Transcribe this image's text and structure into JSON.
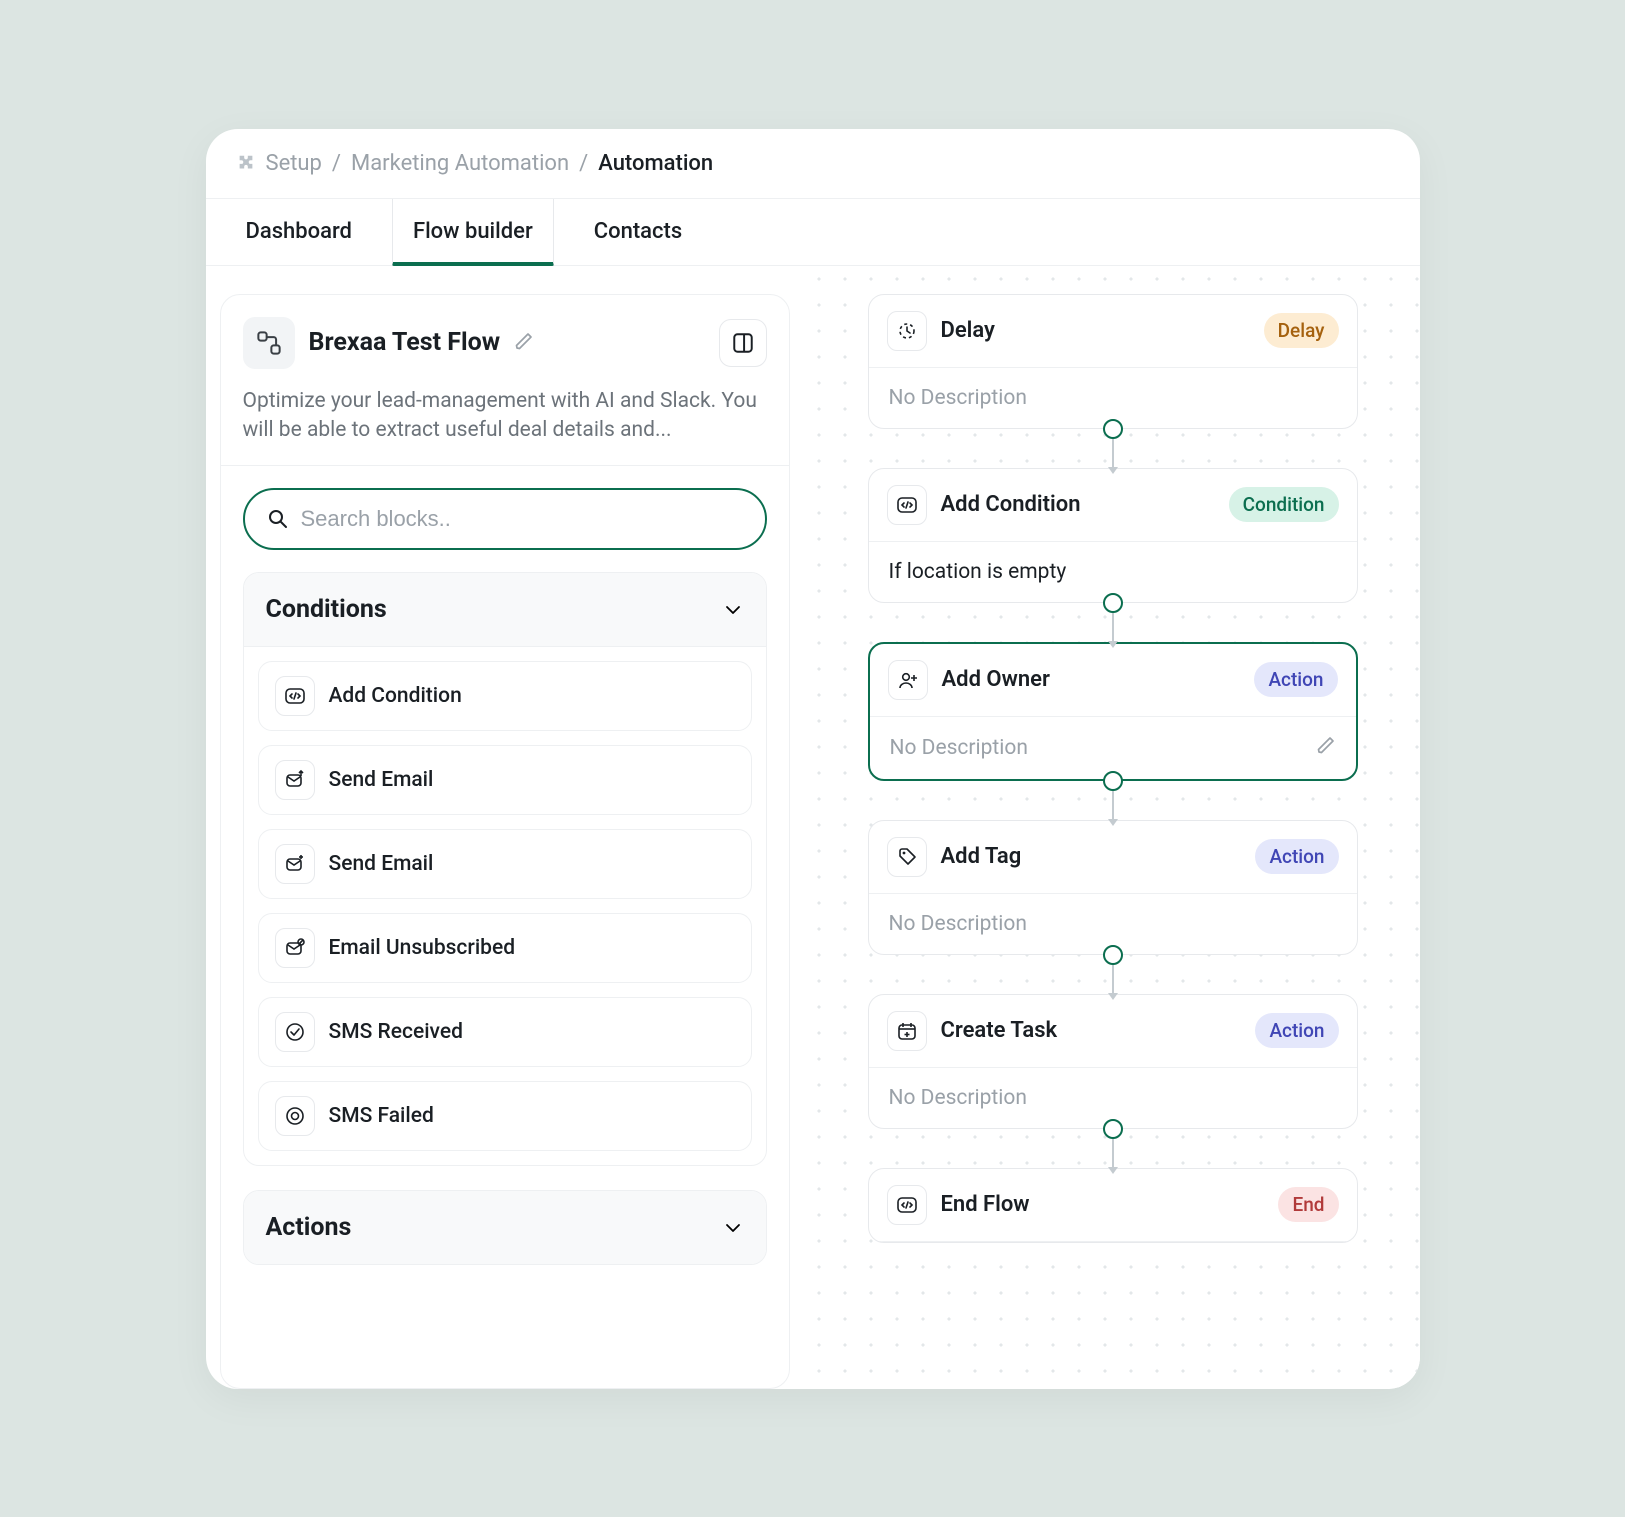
{
  "breadcrumb": {
    "root": "Setup",
    "parent": "Marketing Automation",
    "current": "Automation"
  },
  "tabs": {
    "dashboard": "Dashboard",
    "flow_builder": "Flow builder",
    "contacts": "Contacts"
  },
  "flow": {
    "title": "Brexaa Test Flow",
    "description": "Optimize your lead-management with AI and Slack. You will be able to extract useful deal details and..."
  },
  "search": {
    "placeholder": "Search blocks.."
  },
  "groups": {
    "conditions": {
      "title": "Conditions",
      "items": [
        {
          "label": "Add Condition",
          "icon": "code"
        },
        {
          "label": "Send Email",
          "icon": "mail-up"
        },
        {
          "label": "Send Email",
          "icon": "mail-plus"
        },
        {
          "label": "Email Unsubscribed",
          "icon": "mail-block"
        },
        {
          "label": "SMS Received",
          "icon": "check-circle"
        },
        {
          "label": "SMS Failed",
          "icon": "target"
        }
      ]
    },
    "actions": {
      "title": "Actions"
    }
  },
  "nodes": [
    {
      "title": "Delay",
      "icon": "clock",
      "badge": "Delay",
      "badge_class": "badge-delay",
      "body": "No Description",
      "has_text": false,
      "selected": false,
      "editable": false
    },
    {
      "title": "Add Condition",
      "icon": "code",
      "badge": "Condition",
      "badge_class": "badge-condition",
      "body": "If location is empty",
      "has_text": true,
      "selected": false,
      "editable": false
    },
    {
      "title": "Add Owner",
      "icon": "user-plus",
      "badge": "Action",
      "badge_class": "badge-action",
      "body": "No Description",
      "has_text": false,
      "selected": true,
      "editable": true
    },
    {
      "title": "Add Tag",
      "icon": "tag",
      "badge": "Action",
      "badge_class": "badge-action",
      "body": "No Description",
      "has_text": false,
      "selected": false,
      "editable": false
    },
    {
      "title": "Create Task",
      "icon": "calendar-plus",
      "badge": "Action",
      "badge_class": "badge-action",
      "body": "No Description",
      "has_text": false,
      "selected": false,
      "editable": false
    },
    {
      "title": "End Flow",
      "icon": "code",
      "badge": "End",
      "badge_class": "badge-end",
      "body": "",
      "has_text": false,
      "selected": false,
      "editable": false,
      "nobody": true
    }
  ]
}
